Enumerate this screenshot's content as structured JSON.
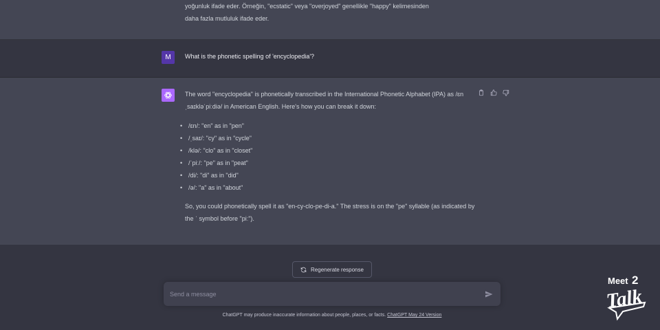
{
  "previous_message": {
    "lines": [
      "yoğunluk ifade eder. Örneğin, \"ecstatic\" veya \"overjoyed\" genellikle \"happy\" kelimesinden",
      "daha fazla mutluluk ifade eder."
    ]
  },
  "user_message": {
    "avatar_letter": "M",
    "text": "What is the phonetic spelling of 'encyclopedia'?"
  },
  "assistant_message": {
    "intro": "The word \"encyclopedia\" is phonetically transcribed in the International Phonetic Alphabet (IPA) as /ɛnˌsaɪkləˈpiːdiə/ in American English. Here's how you can break it down:",
    "bullets": [
      "/ɛn/: \"en\" as in \"pen\"",
      "/ˌsaɪ/: \"cy\" as in \"cycle\"",
      "/klə/: \"clo\" as in \"closet\"",
      "/ˈpiː/: \"pe\" as in \"peat\"",
      "/di/: \"di\" as in \"did\"",
      "/ə/: \"a\" as in \"about\""
    ],
    "conclusion": "So, you could phonetically spell it as \"en-cy-clo-pe-di-a.\" The stress is on the \"pe\" syllable (as indicated by the ˈ symbol before \"piː\")."
  },
  "actions": {
    "regenerate_label": "Regenerate response"
  },
  "composer": {
    "placeholder": "Send a message"
  },
  "footer": {
    "disclaimer": "ChatGPT may produce inaccurate information about people, places, or facts.",
    "version_link": "ChatGPT May 24 Version"
  },
  "watermark": {
    "line1": "Meet",
    "number": "2",
    "line2": "Talk"
  },
  "colors": {
    "background": "#343541",
    "assistant_band": "#444654",
    "user_avatar": "#5436a8",
    "assistant_avatar": "#ab68ff",
    "composer": "#40414f"
  },
  "icons": {
    "sidebar_toggle": "sidebar-icon",
    "assistant_avatar": "openai-logo-icon",
    "copy": "clipboard-icon",
    "thumbs_up": "thumbs-up-icon",
    "thumbs_down": "thumbs-down-icon",
    "regenerate": "refresh-icon",
    "send": "send-icon"
  }
}
